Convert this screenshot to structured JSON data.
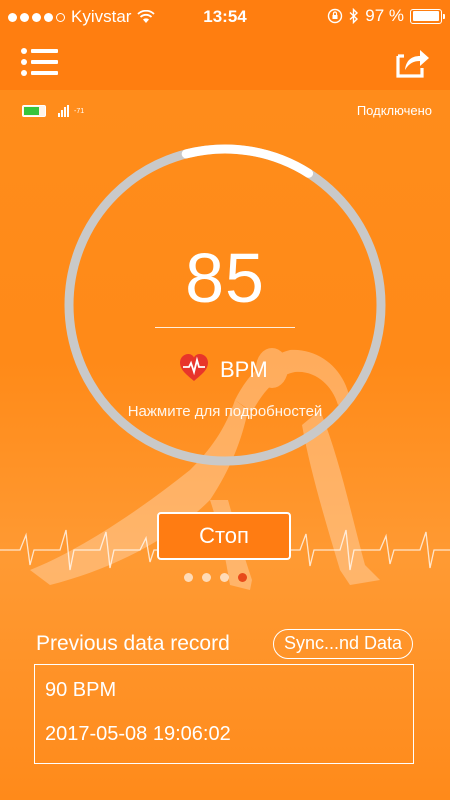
{
  "status_bar": {
    "carrier": "Kyivstar",
    "time": "13:54",
    "battery_percent": "97 %",
    "signal_dots_filled": 4,
    "signal_dots_total": 5,
    "battery_level": 0.97
  },
  "nav": {
    "menu_icon": "list-menu-icon",
    "share_icon": "share-export-icon"
  },
  "device": {
    "battery_icon": "device-battery-icon",
    "signal_icon": "device-signal-icon",
    "rssi": "-71",
    "connection_status": "Подключено"
  },
  "gauge": {
    "value": "85",
    "unit": "BPM",
    "hint": "Нажмите для подробностей",
    "progress_start": 0.96,
    "progress_end": 0.09
  },
  "controls": {
    "stop_label": "Стоп"
  },
  "pager": {
    "count": 4,
    "active_index": 3
  },
  "previous": {
    "title": "Previous data record",
    "sync_label": "Sync...nd Data",
    "record_bpm": "90 BPM",
    "record_time": "2017-05-08 19:06:02"
  },
  "colors": {
    "background": "#ff8a1a",
    "bar": "#ff7e10",
    "gauge_track": "#c9c9c9",
    "gauge_progress": "#ffffff",
    "heart": "#e8352a",
    "active_dot": "#e84a1a"
  }
}
